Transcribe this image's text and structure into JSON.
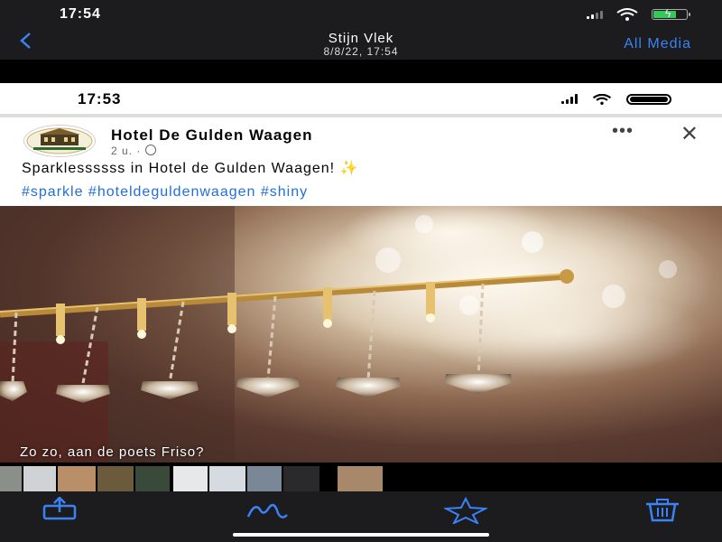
{
  "outer_status": {
    "time": "17:54"
  },
  "nav": {
    "title": "Stijn Vlek",
    "subtitle": "8/8/22, 17:54",
    "all_media": "All Media",
    "back_icon": "chevron-left-icon"
  },
  "inner_status": {
    "time": "17:53"
  },
  "post": {
    "page_name": "Hotel De Gulden Waagen",
    "meta": "2 u. ·",
    "text": "Sparklessssss in Hotel de Gulden Waagen!",
    "emoji": "✨",
    "hashtags": "#sparkle #hoteldeguldenwaagen #shiny",
    "more": "•••",
    "close": "✕"
  },
  "photo": {
    "caption": "Zo zo, aan de poets Friso?"
  },
  "toolbar": {
    "share_icon": "share-icon",
    "markup_icon": "markup-icon",
    "favorite_icon": "star-icon",
    "delete_icon": "trash-icon"
  },
  "colors": {
    "accent": "#3b82f6",
    "hashtag": "#216fdb",
    "bar": "#1c1c1e"
  }
}
